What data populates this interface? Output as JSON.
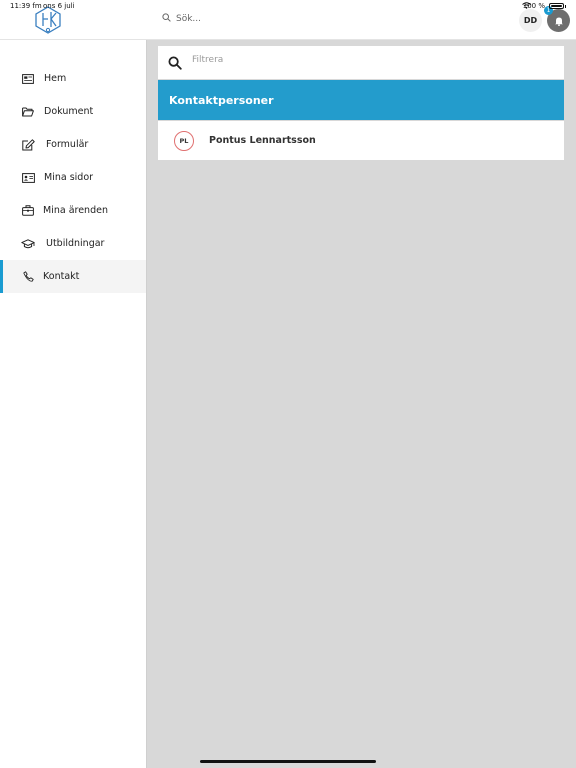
{
  "status_bar": {
    "time": "11:39 fm",
    "date": "ons 6 juli",
    "battery_percent": "100 %"
  },
  "header": {
    "search_placeholder": "Sök...",
    "user_initials": "DD",
    "notification_count": "1"
  },
  "sidebar": {
    "items": [
      {
        "label": "Hem",
        "icon": "home-icon",
        "active": false
      },
      {
        "label": "Dokument",
        "icon": "folder-icon",
        "active": false
      },
      {
        "label": "Formulär",
        "icon": "edit-icon",
        "active": false
      },
      {
        "label": "Mina sidor",
        "icon": "id-card-icon",
        "active": false
      },
      {
        "label": "Mina ärenden",
        "icon": "briefcase-icon",
        "active": false
      },
      {
        "label": "Utbildningar",
        "icon": "graduation-cap-icon",
        "active": false
      },
      {
        "label": "Kontakt",
        "icon": "phone-icon",
        "active": true
      }
    ]
  },
  "main": {
    "filter_placeholder": "Filtrera",
    "section_title": "Kontaktpersoner",
    "contacts": [
      {
        "initials": "PL",
        "name": "Pontus Lennartsson"
      }
    ]
  },
  "colors": {
    "accent": "#239ccc",
    "badge": "#1a9bd1",
    "avatar_border": "#e07070"
  }
}
